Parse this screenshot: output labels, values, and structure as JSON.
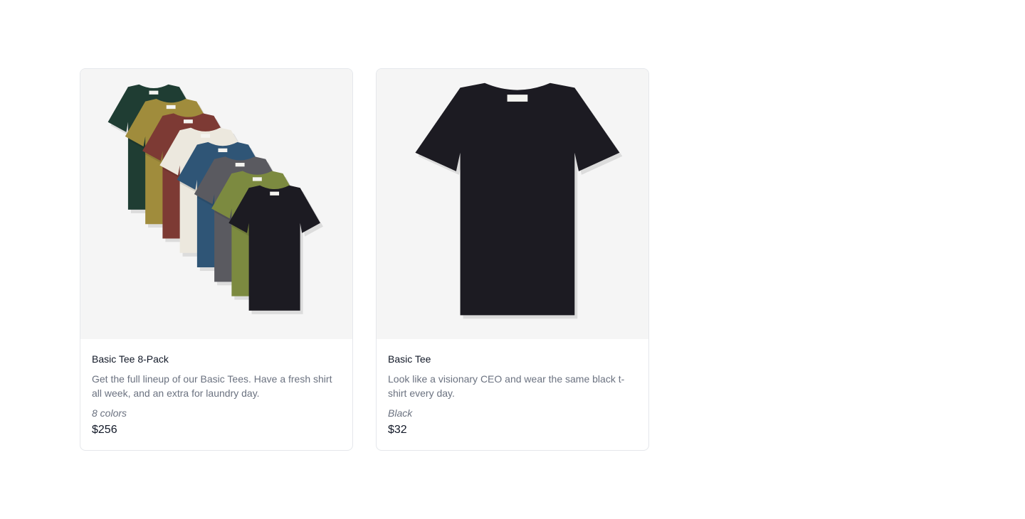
{
  "products": [
    {
      "name": "Basic Tee 8-Pack",
      "description": "Get the full lineup of our Basic Tees. Have a fresh shirt all week, and an extra for laundry day.",
      "options": "8 colors",
      "price": "$256",
      "image_icon": "tshirt-stack-image",
      "shirt_colors": [
        "#1f3d33",
        "#a08c3c",
        "#7d3a34",
        "#ece8de",
        "#2f5576",
        "#5a5a60",
        "#7c8a40",
        "#1c1b22"
      ]
    },
    {
      "name": "Basic Tee",
      "description": "Look like a visionary CEO and wear the same black t-shirt every day.",
      "options": "Black",
      "price": "$32",
      "image_icon": "tshirt-image",
      "shirt_colors": [
        "#1c1b22"
      ]
    }
  ],
  "colors": {
    "card_border": "#e5e7eb",
    "image_background": "#f5f5f5",
    "title_text": "#111827",
    "muted_text": "#6b7280"
  }
}
